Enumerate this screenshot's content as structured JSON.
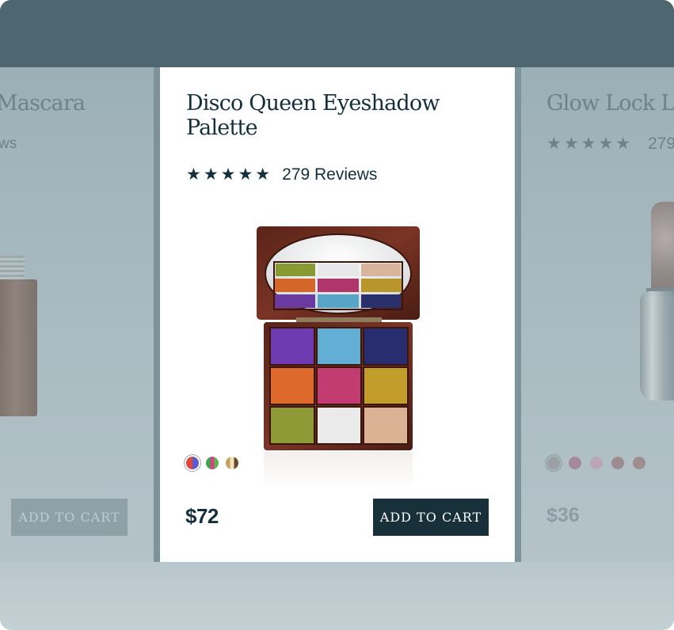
{
  "left_card": {
    "title": "Mascara",
    "reviews_fragment": "ws",
    "add_to_cart_label": "ADD TO CART"
  },
  "featured_card": {
    "title": "Disco Queen Eyeshadow Palette",
    "stars": "★★★★★",
    "rating": 5,
    "reviews": "279 Reviews",
    "price": "$72",
    "add_to_cart_label": "ADD TO CART",
    "swatches": [
      {
        "name": "swatch-red-blue",
        "selected": true
      },
      {
        "name": "swatch-green-pink",
        "selected": false
      },
      {
        "name": "swatch-gold-brown",
        "selected": false
      }
    ]
  },
  "right_card": {
    "title": "Glow Lock Li",
    "stars": "★★★★★",
    "reviews": "279",
    "price": "$36",
    "swatches": [
      {
        "color": "#9aa0a3",
        "selected": true
      },
      {
        "color": "#a58a9b",
        "selected": false
      },
      {
        "color": "#b9a7b8",
        "selected": false
      },
      {
        "color": "#9c8b90",
        "selected": false
      },
      {
        "color": "#a08d90",
        "selected": false
      }
    ]
  },
  "colors": {
    "primary_dark": "#17303a",
    "background_overlay": "#4e666f",
    "card_background": "#ffffff"
  }
}
